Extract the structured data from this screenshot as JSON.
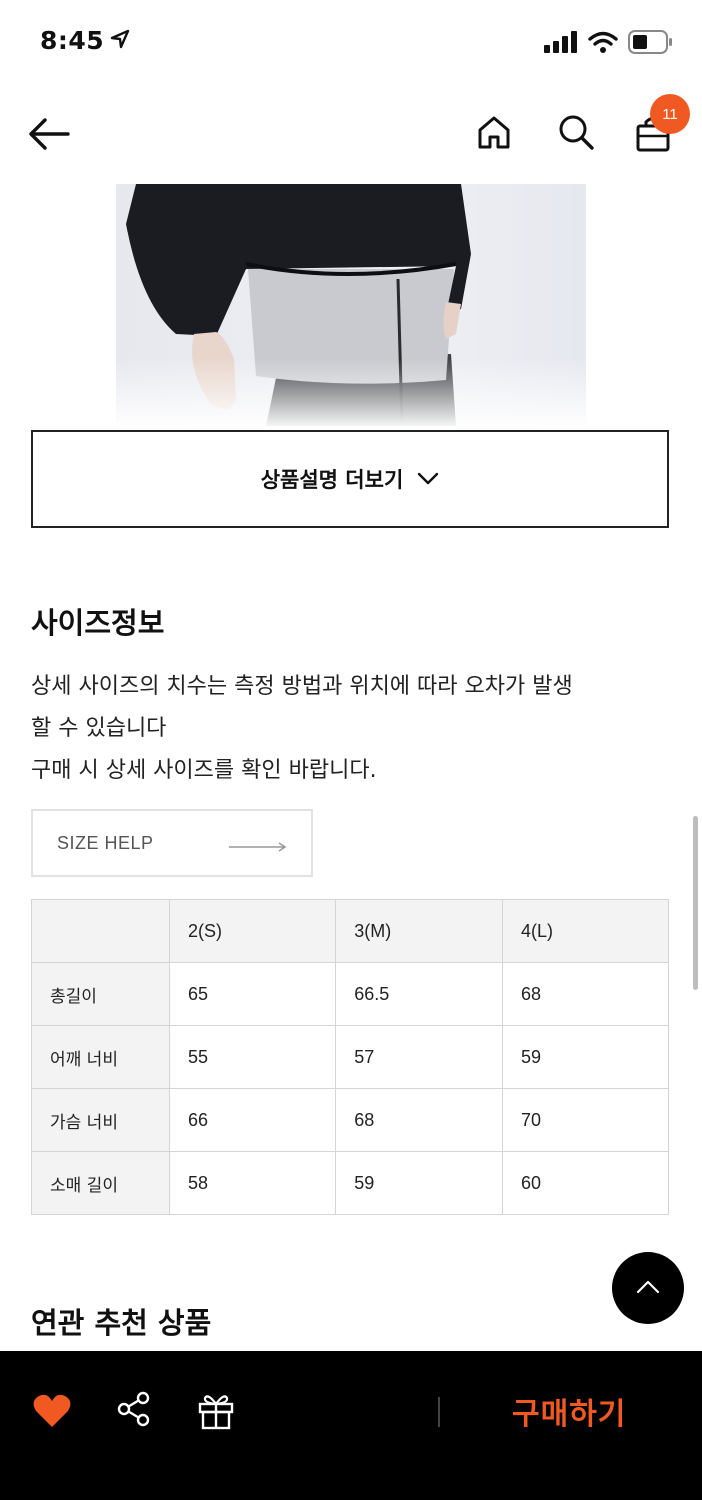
{
  "status_bar": {
    "time": "8:45",
    "location_icon": "location-arrow-icon",
    "signal_icon": "cellular-signal-icon",
    "wifi_icon": "wifi-icon",
    "battery_icon": "battery-icon"
  },
  "header": {
    "back_icon": "arrow-left-icon",
    "home_icon": "home-icon",
    "search_icon": "search-icon",
    "cart_icon": "shopping-bag-icon",
    "cart_count": "11"
  },
  "product": {
    "more_button_label": "상품설명 더보기",
    "more_button_icon": "chevron-down-icon"
  },
  "size_info": {
    "title": "사이즈정보",
    "description_lines": [
      "상세 사이즈의 치수는 측정 방법과 위치에 따라 오차가 발생",
      "할 수 있습니다",
      "구매 시 상세 사이즈를 확인 바랍니다."
    ],
    "help_label": "SIZE HELP",
    "table": {
      "columns": [
        "",
        "2(S)",
        "3(M)",
        "4(L)"
      ],
      "rows": [
        [
          "총길이",
          "65",
          "66.5",
          "68"
        ],
        [
          "어깨 너비",
          "55",
          "57",
          "59"
        ],
        [
          "가슴 너비",
          "66",
          "68",
          "70"
        ],
        [
          "소매 길이",
          "58",
          "59",
          "60"
        ]
      ]
    }
  },
  "recommended": {
    "title": "연관 추천 상품"
  },
  "bottom_bar": {
    "heart_icon": "heart-icon",
    "share_icon": "share-icon",
    "gift_icon": "gift-icon",
    "buy_label": "구매하기"
  },
  "colors": {
    "accent": "#f05a22",
    "bottom_bar_bg": "#000000",
    "table_header_bg": "#f3f3f3"
  }
}
